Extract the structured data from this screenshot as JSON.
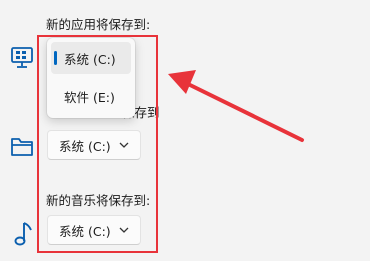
{
  "sections": [
    {
      "label": "新的应用将保存到:",
      "icon": "monitor-icon"
    },
    {
      "label_fragment": "保存到",
      "value": "系统 (C:)",
      "icon": "folder-icon"
    },
    {
      "label": "新的音乐将保存到:",
      "value": "系统 (C:)",
      "icon": "music-note-icon"
    }
  ],
  "dropdown": {
    "options": [
      "系统 (C:)",
      "软件 (E:)"
    ],
    "selected": "系统 (C:)"
  },
  "colors": {
    "accent": "#0067c0",
    "annotation": "#e8333a",
    "icon": "#0b5fae"
  }
}
